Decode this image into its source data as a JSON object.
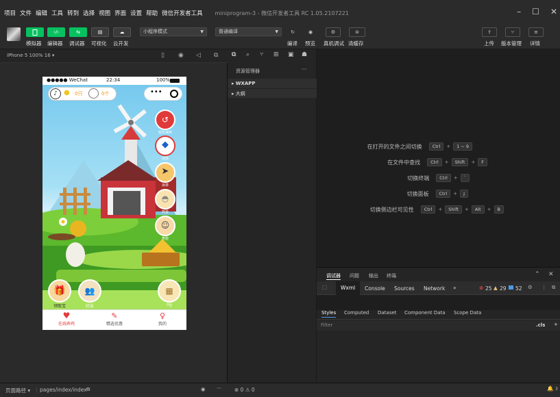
{
  "menubar": {
    "items": [
      "项目",
      "文件",
      "编辑",
      "工具",
      "转到",
      "选择",
      "视图",
      "界面",
      "设置",
      "帮助",
      "微信开发者工具"
    ],
    "title": "miniprogram-3 - 微信开发者工具 RC 1.05.2107221"
  },
  "toolbar": {
    "left_labels": [
      "模拟器",
      "编辑器",
      "调试器",
      "可视化",
      "云开发"
    ],
    "mode_select": "小程序模式",
    "compile_select": "普通编译",
    "mid_labels": [
      "编译",
      "预览",
      "真机调试",
      "清缓存"
    ],
    "right_labels": [
      "上传",
      "版本管理",
      "详情"
    ]
  },
  "simulator": {
    "device": "iPhone 5 100% 16 ▾",
    "status_carrier": "●●●●● WeChat",
    "status_time": "22:34",
    "status_battery": "100%",
    "counter1": "0只",
    "counter2": "0个",
    "side_buttons": [
      "轻松抽奖",
      "动态",
      "派单",
      "鸡蛋",
      "笑脸"
    ],
    "bottom_left_label": "领取宝",
    "bottom_mid_label": "好友",
    "bottom_right_label": "0g",
    "tabs": [
      "在线养鸡",
      "精选优惠",
      "我的"
    ]
  },
  "explorer": {
    "title": "资源管理器",
    "more": "···",
    "items": [
      "WXAPP",
      "大纲"
    ]
  },
  "shortcuts": [
    {
      "label": "在打开的文件之间切换",
      "keys": [
        "Ctrl",
        "1 ~ 9"
      ]
    },
    {
      "label": "在文件中查找",
      "keys": [
        "Ctrl",
        "Shift",
        "F"
      ]
    },
    {
      "label": "切换终端",
      "keys": [
        "Ctrl",
        "`"
      ]
    },
    {
      "label": "切换面板",
      "keys": [
        "Ctrl",
        "J"
      ]
    },
    {
      "label": "切换侧边栏可见性",
      "keys": [
        "Ctrl",
        "Shift",
        "Alt",
        "B"
      ]
    }
  ],
  "debug": {
    "panel_tabs": [
      "调试器",
      "问题",
      "输出",
      "终端"
    ],
    "tabs": [
      "Wxml",
      "Console",
      "Sources",
      "Network",
      "»"
    ],
    "errors": "25",
    "warnings": "29",
    "infos": "52",
    "sub_tabs": [
      "Styles",
      "Computed",
      "Dataset",
      "Component Data",
      "Scope Data"
    ],
    "filter_placeholder": "Filter",
    "cls": ".cls",
    "plus": "+"
  },
  "statusbar": {
    "path_label": "页面路径 ▾",
    "path": "pages/index/index",
    "problems": "⊗ 0 ⚠ 0",
    "bell_count": "3"
  },
  "colors": {
    "accent_green": "#07c160",
    "error": "#f14c4c",
    "warning": "#e5c07b",
    "info": "#4e9be5",
    "tab_red": "#e4393c"
  }
}
